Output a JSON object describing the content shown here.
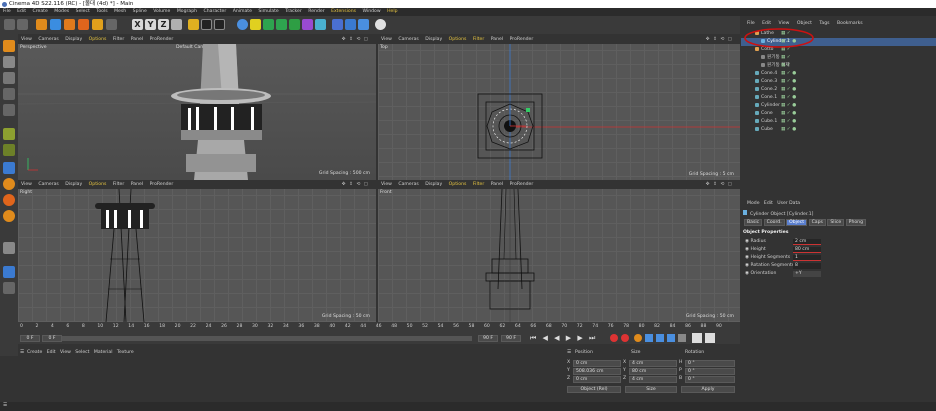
{
  "window": {
    "title": "Cinema 4D S22.116 (RC) - [몰대 (4d) *] - Main"
  },
  "menubar": {
    "items": [
      "File",
      "Edit",
      "Create",
      "Modes",
      "Select",
      "Tools",
      "Mesh",
      "Spline",
      "Volume",
      "Mograph",
      "Character",
      "Animate",
      "Simulate",
      "Tracker",
      "Render",
      "Extensions",
      "Window",
      "Help"
    ],
    "mode_space_label": "Node Space:",
    "mode_space_value": "Current (Standard/Physical)"
  },
  "toolbar": {
    "x": "X",
    "y": "Y",
    "z": "Z"
  },
  "viewports": {
    "menu": [
      "View",
      "Cameras",
      "Display",
      "Options",
      "Filter",
      "Panel",
      "ProRender"
    ],
    "perspective": {
      "label": "Perspective",
      "camera": "Default Camera ○",
      "grid": "Grid Spacing : 500 cm"
    },
    "top": {
      "label": "Top",
      "grid": "Grid Spacing : 5 cm"
    },
    "right": {
      "label": "Right",
      "grid": "Grid Spacing : 50 cm"
    },
    "front": {
      "label": "Front",
      "grid": "Grid Spacing : 50 cm"
    }
  },
  "object_manager": {
    "menu": [
      "File",
      "Edit",
      "View",
      "Object",
      "Tags",
      "Bookmarks"
    ],
    "objects": [
      {
        "name": "Lathe",
        "color": "#e0a050"
      },
      {
        "name": "Cylinder.1",
        "color": "#6ab0e0"
      },
      {
        "name": "Cotto",
        "color": "#e0a050"
      },
      {
        "name": "원기둥",
        "color": "#888888"
      },
      {
        "name": "원기둥 복제",
        "color": "#888888"
      },
      {
        "name": "Cone.4",
        "color": "#6ab0e0"
      },
      {
        "name": "Cone.3",
        "color": "#6ab0e0"
      },
      {
        "name": "Cone.2",
        "color": "#6ab0e0"
      },
      {
        "name": "Cone.1",
        "color": "#6ab0e0"
      },
      {
        "name": "Cylinder",
        "color": "#6ab0e0"
      },
      {
        "name": "Cone",
        "color": "#6ab0e0"
      },
      {
        "name": "Cube.1",
        "color": "#6ab0e0"
      },
      {
        "name": "Cube",
        "color": "#6ab0e0"
      }
    ]
  },
  "attributes": {
    "menu": [
      "Mode",
      "Edit",
      "User Data"
    ],
    "object_title": "Cylinder Object [Cylinder.1]",
    "tabs": [
      "Basic",
      "Coord.",
      "Object",
      "Caps",
      "Slice",
      "Phong"
    ],
    "section": "Object Properties",
    "fields": [
      {
        "label": "Radius",
        "value": "2 cm"
      },
      {
        "label": "Height",
        "value": "80 cm"
      },
      {
        "label": "Height Segments",
        "value": "1"
      },
      {
        "label": "Rotation Segments",
        "value": "8"
      },
      {
        "label": "Orientation",
        "value": "+Y"
      }
    ]
  },
  "timeline": {
    "ticks": [
      "0",
      "2",
      "4",
      "6",
      "8",
      "10",
      "12",
      "14",
      "16",
      "18",
      "20",
      "22",
      "24",
      "26",
      "28",
      "30",
      "32",
      "34",
      "36",
      "38",
      "40",
      "42",
      "44",
      "46",
      "48",
      "50",
      "52",
      "54",
      "56",
      "58",
      "60",
      "62",
      "64",
      "66",
      "68",
      "70",
      "72",
      "74",
      "76",
      "78",
      "80",
      "82",
      "84",
      "86",
      "88",
      "90"
    ],
    "current_frame": "0 F",
    "start": "0 F",
    "end": "90 F",
    "end2": "90 F"
  },
  "material_manager": {
    "menu": [
      "Create",
      "Edit",
      "View",
      "Select",
      "Material",
      "Texture"
    ]
  },
  "coordinates": {
    "headers": [
      "Position",
      "Size",
      "Rotation"
    ],
    "rows": [
      {
        "axis": "X",
        "pos": "0 cm",
        "saxis": "X",
        "size": "4 cm",
        "raxis": "H",
        "rot": "0 °"
      },
      {
        "axis": "Y",
        "pos": "508.036 cm",
        "saxis": "Y",
        "size": "80 cm",
        "raxis": "P",
        "rot": "0 °"
      },
      {
        "axis": "Z",
        "pos": "0 cm",
        "saxis": "Z",
        "size": "4 cm",
        "raxis": "B",
        "rot": "0 °"
      }
    ],
    "mode": "Object (Rel)",
    "size_mode": "Size",
    "apply": "Apply"
  },
  "colors": {
    "highlight_circle": "#cc1111",
    "accent_yellow": "#e6c440",
    "selected_tab": "#5a7fcf"
  }
}
